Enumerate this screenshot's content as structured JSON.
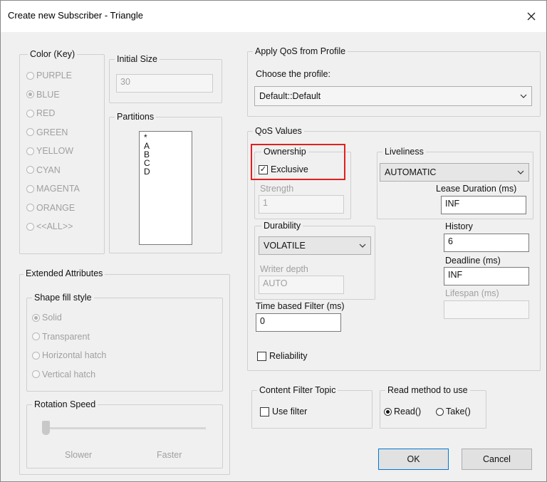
{
  "window": {
    "title": "Create new Subscriber - Triangle",
    "close_icon": "close-icon"
  },
  "color_key": {
    "label": "Color (Key)",
    "options": [
      "PURPLE",
      "BLUE",
      "RED",
      "GREEN",
      "YELLOW",
      "CYAN",
      "MAGENTA",
      "ORANGE",
      "<<ALL>>"
    ],
    "selected": "BLUE"
  },
  "initial_size": {
    "label": "Initial Size",
    "value": "30"
  },
  "partitions": {
    "label": "Partitions",
    "items": [
      "*",
      "A",
      "B",
      "C",
      "D"
    ]
  },
  "extended": {
    "label": "Extended Attributes",
    "fill_label": "Shape fill style",
    "fill_options": [
      "Solid",
      "Transparent",
      "Horizontal hatch",
      "Vertical hatch"
    ],
    "fill_selected": "Solid",
    "rotation_label": "Rotation Speed",
    "slower": "Slower",
    "faster": "Faster"
  },
  "qos_profile": {
    "label": "Apply QoS from Profile",
    "choose_label": "Choose the profile:",
    "selected": "Default::Default"
  },
  "qos": {
    "label": "QoS Values",
    "ownership_label": "Ownership",
    "exclusive_label": "Exclusive",
    "exclusive_checked": true,
    "strength_label": "Strength",
    "strength_value": "1",
    "durability_label": "Durability",
    "durability_value": "VOLATILE",
    "writer_depth_label": "Writer depth",
    "writer_depth_value": "AUTO",
    "time_filter_label": "Time based Filter (ms)",
    "time_filter_value": "0",
    "reliability_label": "Reliability",
    "reliability_checked": false,
    "liveliness_label": "Liveliness",
    "liveliness_value": "AUTOMATIC",
    "lease_label": "Lease Duration (ms)",
    "lease_value": "INF",
    "history_label": "History",
    "history_value": "6",
    "deadline_label": "Deadline (ms)",
    "deadline_value": "INF",
    "lifespan_label": "Lifespan (ms)",
    "lifespan_value": ""
  },
  "content_filter": {
    "label": "Content Filter Topic",
    "use_filter_label": "Use filter",
    "checked": false
  },
  "read_method": {
    "label": "Read method to use",
    "read_label": "Read()",
    "take_label": "Take()",
    "selected": "Read()"
  },
  "buttons": {
    "ok": "OK",
    "cancel": "Cancel"
  },
  "colors": {
    "highlight": "#e02020",
    "default_button_border": "#0078d7"
  }
}
